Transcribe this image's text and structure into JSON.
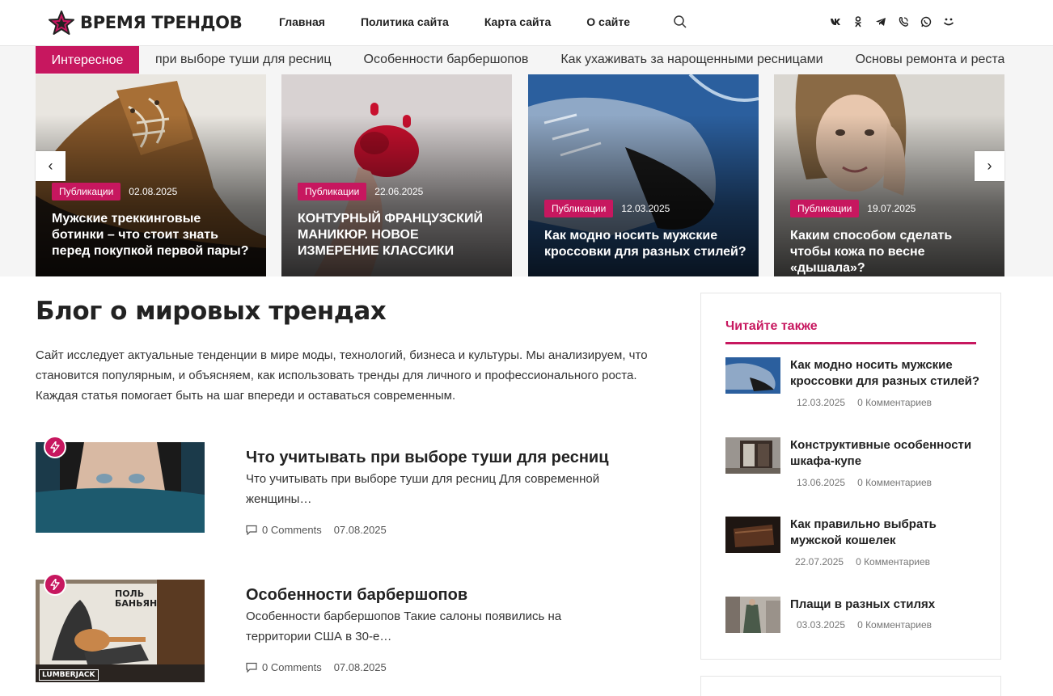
{
  "site": {
    "name": "ВРЕМЯ ТРЕНДОВ"
  },
  "nav": {
    "items": [
      "Главная",
      "Политика сайта",
      "Карта сайта",
      "О сайте"
    ]
  },
  "social": [
    "vk-icon",
    "odnoklassniki-icon",
    "telegram-icon",
    "viber-icon",
    "whatsapp-icon",
    "moimir-icon"
  ],
  "ticker": {
    "label": "Интересное",
    "items": [
      "при выборе туши для ресниц",
      "Особенности барбершопов",
      "Как ухаживать за нарощенными ресницами",
      "Основы ремонта и реставрации"
    ]
  },
  "slider": {
    "slides": [
      {
        "category": "Публикации",
        "date": "02.08.2025",
        "title": "Мужские треккинговые ботинки – что стоит знать перед покупкой первой пары?"
      },
      {
        "category": "Публикации",
        "date": "22.06.2025",
        "title": "КОНТУРНЫЙ ФРАНЦУЗСКИЙ МАНИКЮР. НОВОЕ ИЗМЕРЕНИЕ КЛАССИКИ"
      },
      {
        "category": "Публикации",
        "date": "12.03.2025",
        "title": "Как модно носить мужские кроссовки для разных стилей?"
      },
      {
        "category": "Публикации",
        "date": "19.07.2025",
        "title": "Каким способом сделать чтобы кожа по весне «дышала»?"
      }
    ]
  },
  "main": {
    "title": "Блог о мировых трендах",
    "intro": "Сайт исследует актуальные тенденции в мире моды, технологий, бизнеса и культуры. Мы анализируем, что становится популярным, и объясняем, как использовать тренды для личного и профессионального роста. Каждая статья помогает быть на шаг впереди и оставаться современным.",
    "posts": [
      {
        "title": "Что учитывать при выборе туши для ресниц",
        "excerpt": "Что учитывать при выборе туши для ресниц Для современной женщины…",
        "comments": "0 Comments",
        "date": "07.08.2025"
      },
      {
        "title": "Особенности барбершопов",
        "excerpt": "Особенности барбершопов Такие салоны появились на территории США в 30-е…",
        "comments": "0 Comments",
        "date": "07.08.2025",
        "image_text": {
          "poster": "ПОЛЬ БАНЬЯН",
          "sign": "LUMBERJACK"
        }
      }
    ]
  },
  "sidebar": {
    "title": "Читайте также",
    "items": [
      {
        "title": "Как модно носить мужские кроссовки для разных стилей?",
        "date": "12.03.2025",
        "comments": "0 Комментариев"
      },
      {
        "title": "Конструктивные особенности шкафа-купе",
        "date": "13.06.2025",
        "comments": "0 Комментариев"
      },
      {
        "title": "Как правильно выбрать мужской кошелек",
        "date": "22.07.2025",
        "comments": "0 Комментариев"
      },
      {
        "title": "Плащи в разных стилях",
        "date": "03.03.2025",
        "comments": "0 Комментариев"
      }
    ]
  },
  "colors": {
    "accent": "#c7175f",
    "text": "#222222",
    "ticker_bg": "#f5f5f5"
  }
}
